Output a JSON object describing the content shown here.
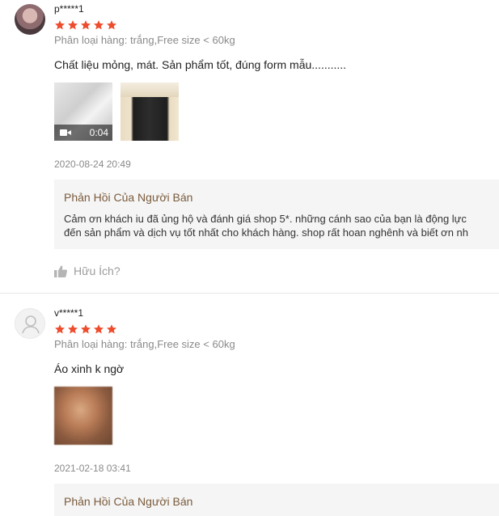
{
  "reviews": [
    {
      "username": "p*****1",
      "rating": 5,
      "variant": "Phân loại hàng: trắng,Free size < 60kg",
      "comment": "Chất liệu mỏng, mát. Sản phẩm tốt, đúng form mẫu...........",
      "video_duration": "0:04",
      "timestamp": "2020-08-24 20:49",
      "seller_reply": {
        "title": "Phản Hồi Của Người Bán",
        "line1": "Cảm ơn khách iu đã ủng hộ và đánh giá shop 5*. những cánh sao của bạn là động lực",
        "line2": "đến sản phẩm và dịch vụ tốt nhất cho khách hàng. shop rất hoan nghênh và biết ơn nh"
      },
      "helpful_label": "Hữu Ích?"
    },
    {
      "username": "v*****1",
      "rating": 5,
      "variant": "Phân loại hàng: trắng,Free size < 60kg",
      "comment": "Áo xinh k ngờ",
      "timestamp": "2021-02-18 03:41",
      "seller_reply": {
        "title": "Phản Hồi Của Người Bán"
      }
    }
  ],
  "colors": {
    "star": "#ee4d2d",
    "seller_title": "#7a5b3c",
    "reply_bg": "#f5f5f5"
  },
  "icons": {
    "video": "video-camera-icon",
    "helpful": "thumbs-up-icon",
    "default_avatar": "user-icon"
  }
}
